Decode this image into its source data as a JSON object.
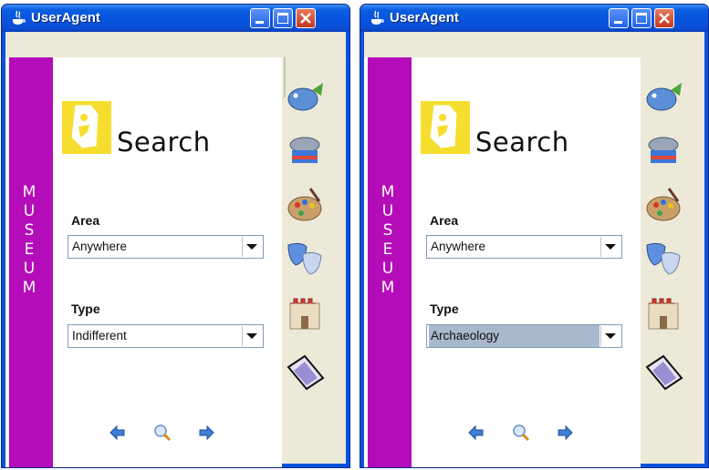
{
  "windows": [
    {
      "title": "UserAgent",
      "museum_letters": [
        "M",
        "U",
        "S",
        "E",
        "U",
        "M"
      ],
      "search_label": "Search",
      "area": {
        "label": "Area",
        "value": "Anywhere"
      },
      "type": {
        "label": "Type",
        "value": "Indifferent",
        "selected": false
      }
    },
    {
      "title": "UserAgent",
      "museum_letters": [
        "M",
        "U",
        "S",
        "E",
        "U",
        "M"
      ],
      "search_label": "Search",
      "area": {
        "label": "Area",
        "value": "Anywhere"
      },
      "type": {
        "label": "Type",
        "value": "Archaeology",
        "selected": true
      }
    }
  ],
  "icons": {
    "title": "java-cup-icon",
    "nav": [
      "back-arrow-icon",
      "search-magnifier-icon",
      "forward-arrow-icon"
    ],
    "side": [
      "fossil-fish-icon",
      "film-reel-icon",
      "paint-palette-icon",
      "theater-masks-icon",
      "castle-icon",
      "book-icon"
    ]
  },
  "colors": {
    "titlebar": "#0853dd",
    "museum_bar": "#b40cb9",
    "logo_bg": "#f5de2e",
    "selected_value_bg": "#a9b8cd",
    "close_button": "#d2452b"
  }
}
